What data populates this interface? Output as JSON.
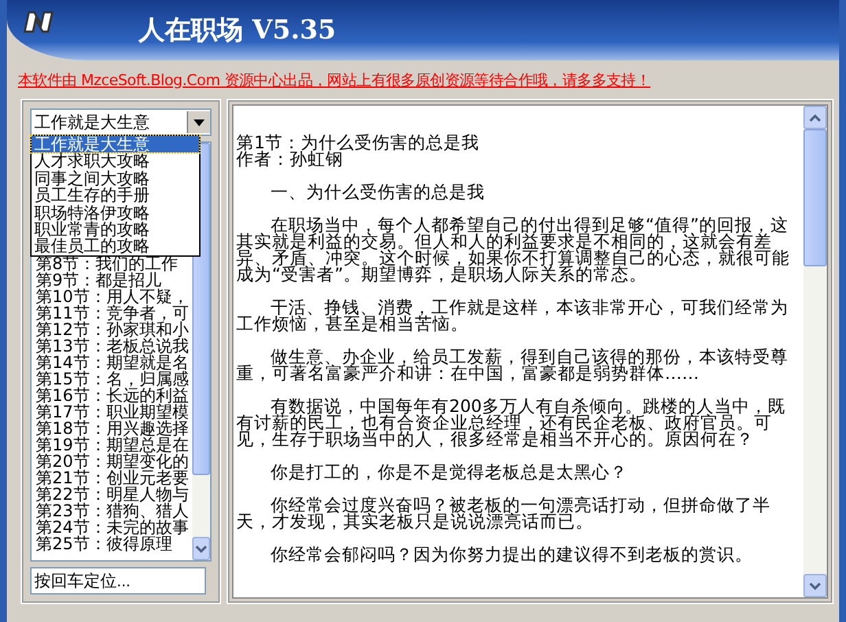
{
  "window": {
    "title": "人在职场 V5.35"
  },
  "banner": "本软件由 MzceSoft.Blog.Com 资源中心出品，网站上有很多原创资源等待合作哦，请多多支持！",
  "category_select": {
    "value": "工作就是大生意",
    "expanded": true,
    "options": [
      {
        "label": "工作就是大生意",
        "selected": true
      },
      {
        "label": "人才求职大攻略",
        "selected": false
      },
      {
        "label": "同事之间大攻略",
        "selected": false
      },
      {
        "label": "员工生存的手册",
        "selected": false
      },
      {
        "label": "职场特洛伊攻略",
        "selected": false
      },
      {
        "label": "职业常青的攻略",
        "selected": false
      },
      {
        "label": "最佳员工的攻略",
        "selected": false
      }
    ]
  },
  "chapters": [
    "第8节：我们的工作",
    "第9节：都是招儿",
    "第10节：用人不疑，",
    "第11节：竞争者，可",
    "第12节：孙家琪和小",
    "第13节：老板总说我",
    "第14节：期望就是名",
    "第15节：名，归属感",
    "第16节：长远的利益",
    "第17节：职业期望模",
    "第18节：用兴趣选择",
    "第19节：期望总是在",
    "第20节：期望变化的",
    "第21节：创业元老要",
    "第22节：明星人物与",
    "第23节：猎狗、猎人",
    "第24节：未完的故事",
    "第25节：彼得原理"
  ],
  "locate_field": {
    "placeholder": "按回车定位..."
  },
  "article": {
    "heading": "第1节：为什么受伤害的总是我",
    "author": "作者：孙虹钢",
    "paragraphs": [
      "一、为什么受伤害的总是我",
      "在职场当中，每个人都希望自己的付出得到足够“值得”的回报，这其实就是利益的交易。但人和人的利益要求是不相同的，这就会有差异、矛盾、冲突。这个时候，如果你不打算调整自己的心态，就很可能成为“受害者”。期望博弈，是职场人际关系的常态。",
      "干活、挣钱、消费，工作就是这样，本该非常开心，可我们经常为工作烦恼，甚至是相当苦恼。",
      "做生意、办企业，给员工发薪，得到自己该得的那份，本该特受尊重，可著名富豪严介和讲：在中国，富豪都是弱势群体……",
      "有数据说，中国每年有200多万人有自杀倾向。跳楼的人当中，既有讨薪的民工，也有合资企业总经理，还有民企老板、政府官员。可见，生存于职场当中的人，很多经常是相当不开心的。原因何在？",
      "你是打工的，你是不是觉得老板总是太黑心？",
      "你经常会过度兴奋吗？被老板的一句漂亮话打动，但拼命做了半天，才发现，其实老板只是说说漂亮话而已。",
      "你经常会郁闷吗？因为你努力提出的建议得不到老板的赏识。"
    ]
  }
}
